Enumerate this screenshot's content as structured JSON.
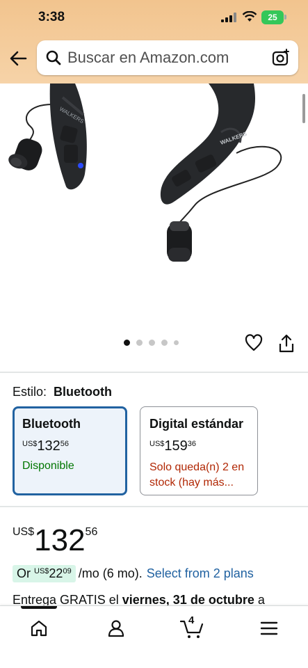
{
  "status_bar": {
    "time": "3:38",
    "battery": "25"
  },
  "header": {
    "search_placeholder": "Buscar en Amazon.com"
  },
  "gallery": {
    "brand_logo": "WALKERS",
    "image_count": 5,
    "active_index": 0
  },
  "style": {
    "label": "Estilo:",
    "value": "Bluetooth",
    "options": [
      {
        "name": "Bluetooth",
        "currency": "US$",
        "whole": "132",
        "fraction": "56",
        "availability": "Disponible",
        "selected": true
      },
      {
        "name": "Digital estándar",
        "currency": "US$",
        "whole": "159",
        "fraction": "36",
        "availability": "Solo queda(n) 2 en stock (hay más...",
        "selected": false
      }
    ]
  },
  "price": {
    "currency": "US$",
    "whole": "132",
    "fraction": "56"
  },
  "plan": {
    "prefix": "Or",
    "currency": "US$",
    "whole": "22",
    "fraction": "09",
    "term": "/mo (6 mo).",
    "link": "Select from 2 plans"
  },
  "delivery": {
    "prefix": "Entrega GRATIS el",
    "date": "viernes, 31 de octubre",
    "suffix": "a"
  },
  "bottom_nav": {
    "cart_count": "4"
  },
  "colors": {
    "header_gradient_top": "#f2c48e",
    "link": "#2162a1",
    "in_stock": "#007600",
    "low_stock": "#b12704",
    "selected_border": "#2162a1"
  }
}
